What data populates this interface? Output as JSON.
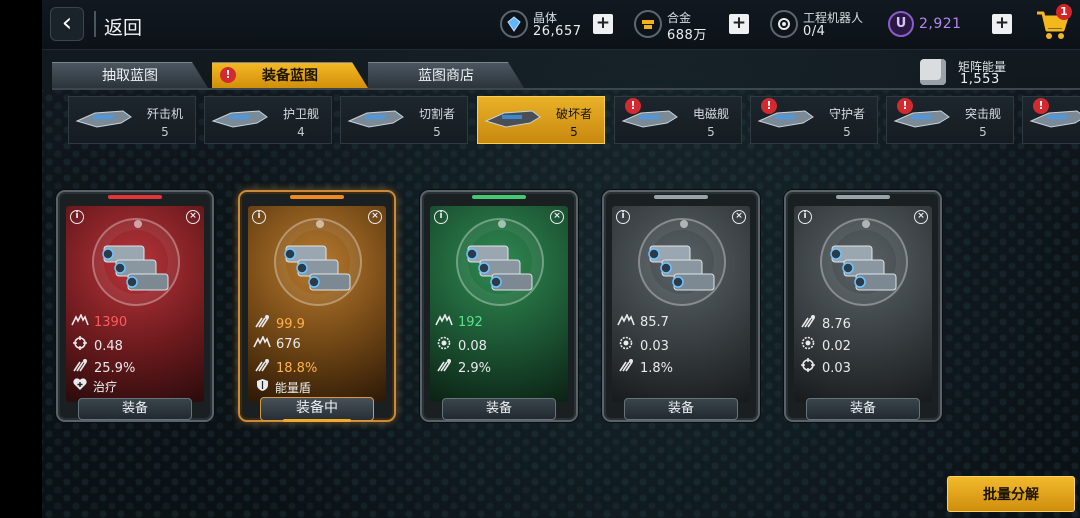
{
  "topbar": {
    "back_label": "返回",
    "resources": [
      {
        "name": "晶体",
        "value": "26,657",
        "icon": "crystal-icon"
      },
      {
        "name": "合金",
        "value": "688万",
        "icon": "alloy-icon"
      },
      {
        "name": "工程机器人",
        "value": "0/4",
        "icon": "robot-icon"
      }
    ],
    "premium": {
      "symbol": "U",
      "value": "2,921",
      "color": "#b586f0"
    },
    "cart_badge": "1"
  },
  "tabs": [
    {
      "label": "抽取蓝图",
      "active": false,
      "alert": false
    },
    {
      "label": "装备蓝图",
      "active": true,
      "alert": true,
      "alert_symbol": "!"
    },
    {
      "label": "蓝图商店",
      "active": false,
      "alert": false
    }
  ],
  "matrix": {
    "name": "矩阵能量",
    "value": "1,553"
  },
  "ships": [
    {
      "name": "歼击机",
      "count": "5",
      "alert": false
    },
    {
      "name": "护卫舰",
      "count": "4",
      "alert": false
    },
    {
      "name": "切割者",
      "count": "5",
      "alert": false
    },
    {
      "name": "破坏者",
      "count": "5",
      "alert": false,
      "active": true
    },
    {
      "name": "电磁舰",
      "count": "5",
      "alert": true
    },
    {
      "name": "守护者",
      "count": "5",
      "alert": true
    },
    {
      "name": "突击舰",
      "count": "5",
      "alert": true
    },
    {
      "name": "",
      "count": "",
      "alert": true
    }
  ],
  "info_symbol": "i",
  "close_symbol": "×",
  "cards": [
    {
      "rarity": "red",
      "accent": "#e3343a",
      "stats": [
        {
          "icon": "damage-icon",
          "value": "1390",
          "highlight": true
        },
        {
          "icon": "crosshair-icon",
          "value": "0.48",
          "highlight": false
        },
        {
          "icon": "crit-icon",
          "value": "25.9%",
          "highlight": false
        }
      ],
      "skill": {
        "icon": "heal-icon",
        "label": "治疗"
      },
      "button": "装备",
      "equipped": false
    },
    {
      "rarity": "orange",
      "accent": "#f08a1c",
      "stats": [
        {
          "icon": "crit-icon",
          "value": "99.9",
          "highlight": true
        },
        {
          "icon": "damage-icon",
          "value": "676",
          "highlight": false
        },
        {
          "icon": "crit-icon",
          "value": "18.8%",
          "highlight": true
        }
      ],
      "skill": {
        "icon": "shield-icon",
        "label": "能量盾"
      },
      "button": "装备中",
      "equipped": true
    },
    {
      "rarity": "green",
      "accent": "#46c86e",
      "stats": [
        {
          "icon": "damage-icon",
          "value": "192",
          "highlight": true
        },
        {
          "icon": "gear-icon",
          "value": "0.08",
          "highlight": false
        },
        {
          "icon": "crit-icon",
          "value": "2.9%",
          "highlight": false
        }
      ],
      "skill": null,
      "button": "装备",
      "equipped": false
    },
    {
      "rarity": "gray",
      "accent": "#9aa3a8",
      "stats": [
        {
          "icon": "damage-icon",
          "value": "85.7",
          "highlight": false
        },
        {
          "icon": "gear-icon",
          "value": "0.03",
          "highlight": false
        },
        {
          "icon": "crit-icon",
          "value": "1.8%",
          "highlight": false
        }
      ],
      "skill": null,
      "button": "装备",
      "equipped": false
    },
    {
      "rarity": "gray",
      "accent": "#9aa3a8",
      "stats": [
        {
          "icon": "crit-icon",
          "value": "8.76",
          "highlight": false
        },
        {
          "icon": "gear-icon",
          "value": "0.02",
          "highlight": false
        },
        {
          "icon": "crosshair-icon",
          "value": "0.03",
          "highlight": false
        }
      ],
      "skill": null,
      "button": "装备",
      "equipped": false
    }
  ],
  "batch_button": "批量分解"
}
